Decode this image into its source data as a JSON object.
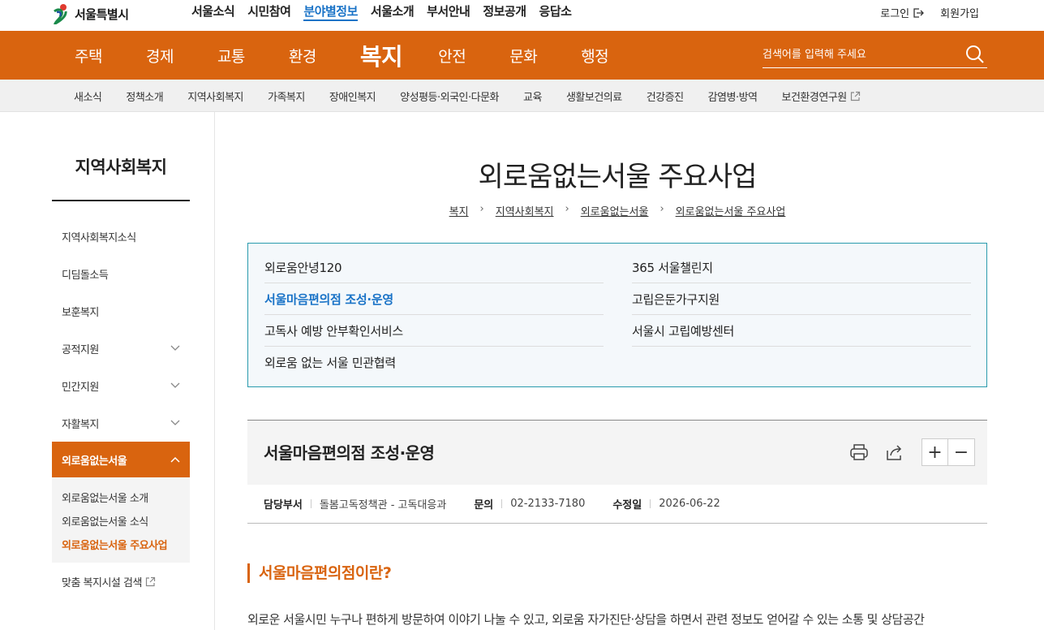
{
  "header": {
    "logo_text": "서울특별시",
    "top_menu": [
      "서울소식",
      "시민참여",
      "분야별정보",
      "서울소개",
      "부서안내",
      "정보공개",
      "응답소"
    ],
    "login": "로그인",
    "join": "회원가입"
  },
  "main_nav": {
    "items": [
      "주택",
      "경제",
      "교통",
      "환경",
      "복지",
      "안전",
      "문화",
      "행정"
    ],
    "active": "복지",
    "search_placeholder": "검색어를 입력해 주세요"
  },
  "sub_nav": {
    "items": [
      "새소식",
      "정책소개",
      "지역사회복지",
      "가족복지",
      "장애인복지",
      "양성평등·외국인·다문화",
      "교육",
      "생활보건의료",
      "건강증진",
      "감염병·방역",
      "보건환경연구원"
    ]
  },
  "sidebar": {
    "title": "지역사회복지",
    "items": [
      "지역사회복지소식",
      "디딤돌소득",
      "보훈복지",
      "공적지원",
      "민간지원",
      "자활복지",
      "외로움없는서울"
    ],
    "sub_items": [
      "외로움없는서울 소개",
      "외로움없는서울 소식",
      "외로움없는서울 주요사업"
    ],
    "extra": "맞춤 복지시설 검색"
  },
  "page": {
    "title": "외로움없는서울 주요사업",
    "breadcrumb": [
      "복지",
      "지역사회복지",
      "외로움없는서울",
      "외로움없는서울 주요사업"
    ]
  },
  "tabs": {
    "col1": [
      "외로움안녕120",
      "서울마음편의점 조성·운영",
      "고독사 예방 안부확인서비스",
      "외로움 없는 서울 민관협력"
    ],
    "col2": [
      "365 서울챌린지",
      "고립은둔가구지원",
      "서울시 고립예방센터"
    ],
    "active": "서울마음편의점 조성·운영"
  },
  "article": {
    "title": "서울마음편의점 조성·운영",
    "dept_label": "담당부서",
    "dept_value": "돌봄고독정책관 - 고독대응과",
    "contact_label": "문의",
    "contact_value": "02-2133-7180",
    "updated_label": "수정일",
    "updated_value": "2026-06-22",
    "zoom_in": "+",
    "zoom_out": "−",
    "section_heading": "서울마음편의점이란?",
    "body": "외로운 서울시민 누구나 편하게 방문하여 이야기 나눌 수 있고, 외로움 자가진단·상담을 하면서 관련 정보도 얻어갈 수 있는 소통 및 상담공간"
  },
  "colors": {
    "brand_orange": "#d9640f",
    "link_blue": "#1a73c7",
    "tab_border": "#2a9aad"
  }
}
